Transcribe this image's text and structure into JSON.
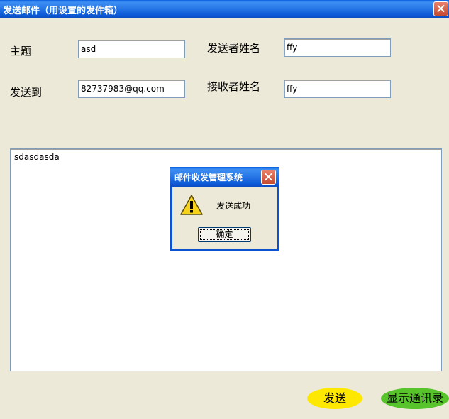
{
  "window": {
    "title": "发送邮件（用设置的发件箱）",
    "close_icon": "close-icon"
  },
  "form": {
    "subject_label": "主题",
    "subject_value": "asd",
    "to_label": "发送到",
    "to_value": "82737983@qq.com",
    "sender_name_label": "发送者姓名",
    "sender_name_value": "ffy",
    "receiver_name_label": "接收者姓名",
    "receiver_name_value": "ffy",
    "body_value": "sdasdasda"
  },
  "dialog": {
    "title": "邮件收发管理系统",
    "message": "发送成功",
    "ok_label": "确定",
    "icon": "warning-icon"
  },
  "buttons": {
    "send_label": "发送",
    "contacts_label": "显示通讯录"
  },
  "colors": {
    "titlebar": "#0C58D6",
    "send_button": "#FFE800",
    "contacts_button": "#56C42A",
    "window_bg": "#ECE9D8"
  }
}
